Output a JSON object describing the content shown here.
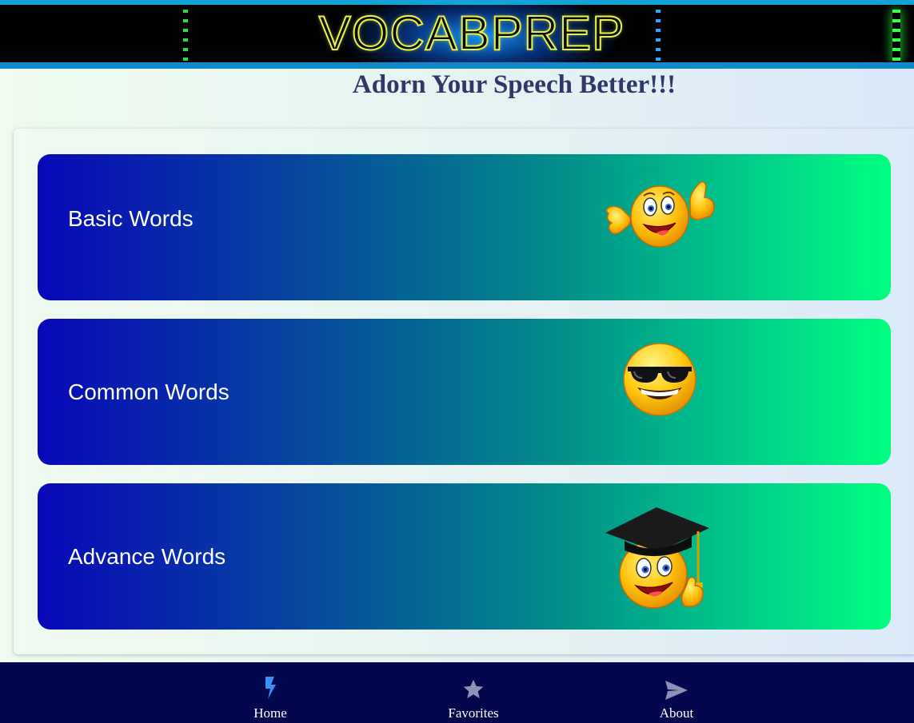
{
  "banner": {
    "logo_text": "VOCABPREP"
  },
  "tagline": "Adorn Your Speech Better!!!",
  "categories": [
    {
      "label": "Basic Words",
      "emoji": "thumbs-up-smiley-icon"
    },
    {
      "label": "Common Words",
      "emoji": "sunglasses-smiley-icon"
    },
    {
      "label": "Advance Words",
      "emoji": "graduate-smiley-icon"
    }
  ],
  "nav": {
    "items": [
      {
        "label": "Home",
        "icon": "lightning-icon",
        "active": true
      },
      {
        "label": "Favorites",
        "icon": "star-icon",
        "active": false
      },
      {
        "label": "About",
        "icon": "send-icon",
        "active": false
      }
    ]
  },
  "colors": {
    "nav_background": "#03074e",
    "tile_gradient_start": "#0808b8",
    "tile_gradient_end": "#00ff80",
    "tagline_color": "#2d3a68",
    "active_nav_icon": "#3d8ff5"
  }
}
